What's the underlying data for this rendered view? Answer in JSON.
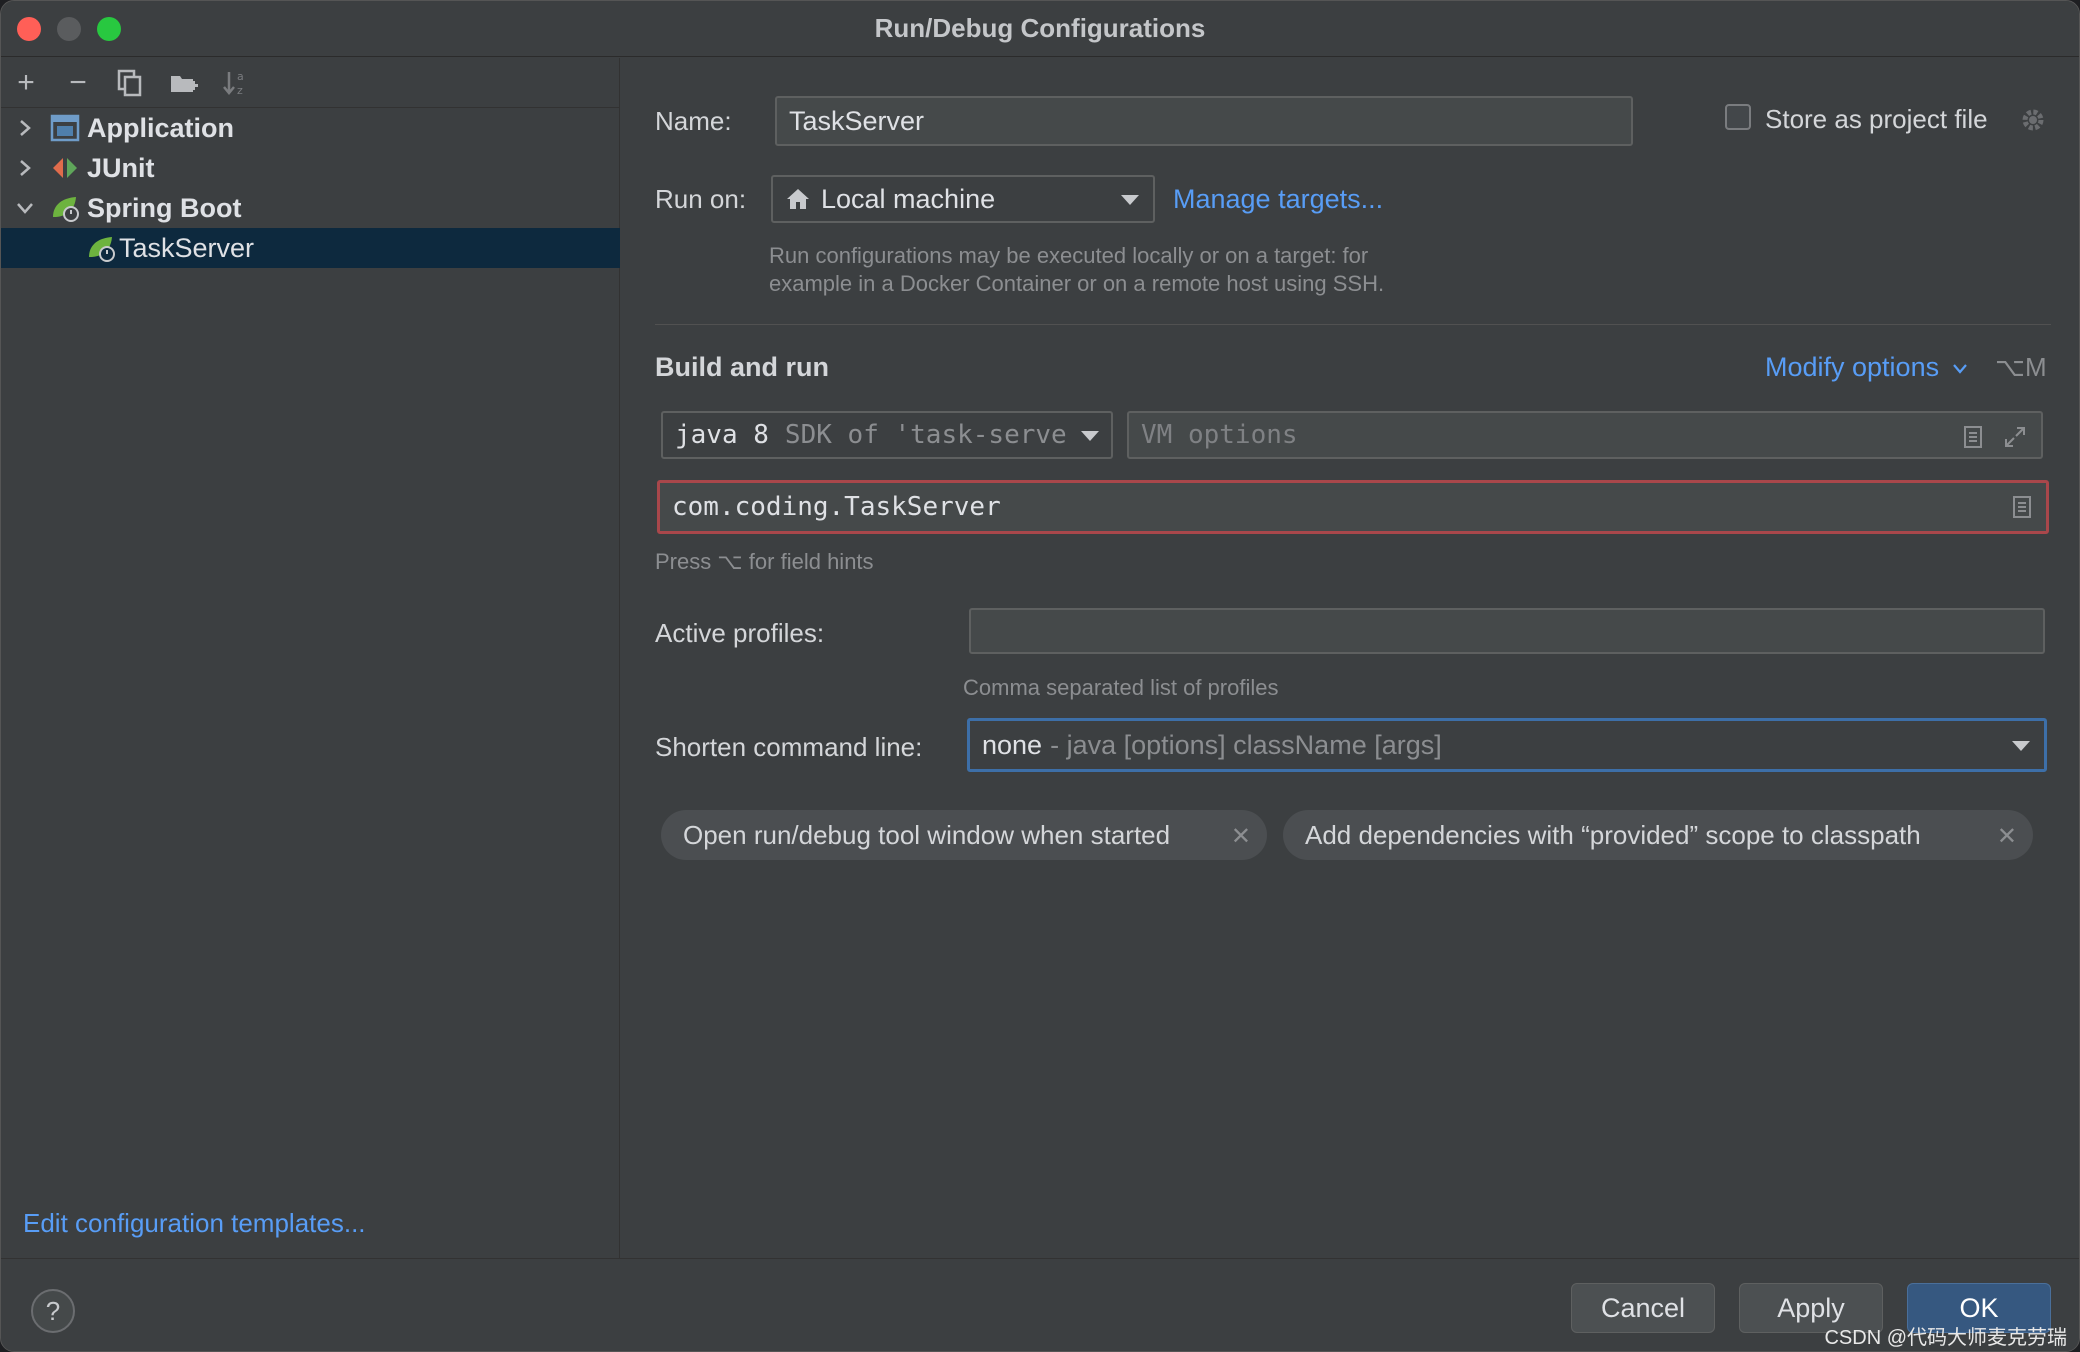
{
  "window": {
    "title": "Run/Debug Configurations"
  },
  "toolbar": {
    "add": "+",
    "remove": "−"
  },
  "tree": {
    "items": [
      {
        "label": "Application",
        "expanded": false
      },
      {
        "label": "JUnit",
        "expanded": false
      },
      {
        "label": "Spring Boot",
        "expanded": true
      },
      {
        "label": "TaskServer",
        "selected": true
      }
    ]
  },
  "left_footer": {
    "edit_templates": "Edit configuration templates..."
  },
  "form": {
    "name_label": "Name:",
    "name_value": "TaskServer",
    "store_label": "Store as project file",
    "run_on_label": "Run on:",
    "run_on_value": "Local machine",
    "manage_targets": "Manage targets...",
    "run_hint_1": "Run configurations may be executed locally or on a target: for",
    "run_hint_2": "example in a Docker Container or on a remote host using SSH.",
    "build_and_run": "Build and run",
    "modify_options": "Modify options",
    "modify_shortcut": "⌥M",
    "jdk_main": "java 8",
    "jdk_detail": "SDK of 'task-serve",
    "vm_options_placeholder": "VM options",
    "main_class": "com.coding.TaskServer",
    "field_hints": "Press ⌥ for field hints",
    "active_profiles_label": "Active profiles:",
    "active_profiles_value": "",
    "profiles_hint": "Comma separated list of profiles",
    "shorten_label": "Shorten command line:",
    "shorten_value": "none",
    "shorten_detail": "- java [options] className [args]",
    "chips": [
      "Open run/debug tool window when started",
      "Add dependencies with “provided” scope to classpath"
    ]
  },
  "footer": {
    "help": "?",
    "cancel": "Cancel",
    "apply": "Apply",
    "ok": "OK",
    "watermark": "CSDN @代码大师麦克劳瑞"
  },
  "colors": {
    "accent": "#589df6",
    "selection": "#0d293e",
    "error_border": "#a9474b",
    "focus_border": "#3d6fa8"
  }
}
